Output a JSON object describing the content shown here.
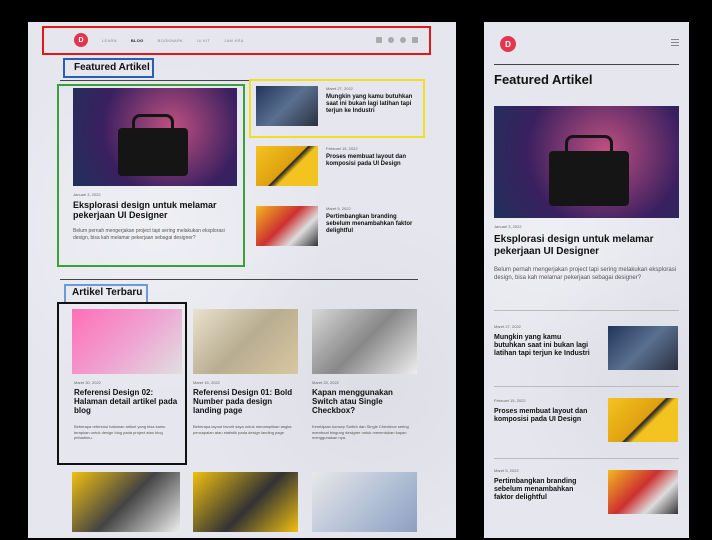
{
  "nav": {
    "logo": "D",
    "links": [
      "LEARN",
      "BLOG",
      "BOOKMARK",
      "UI KIT",
      "JAM KRA"
    ],
    "icons": [
      "share-icon",
      "globe-icon",
      "circle-icon",
      "video-icon"
    ]
  },
  "featured": {
    "title": "Featured Artikel",
    "main": {
      "date": "Januari 3, 2022",
      "title": "Eksplorasi design untuk melamar pekerjaan UI Designer",
      "excerpt": "Belum pernah mengerjakan project tapi sering melakukan eksplorasi design, bisa kah melamar pekerjaan sebagai designer?"
    },
    "side": [
      {
        "date": "Maret 27, 2022",
        "title": "Mungkin yang kamu butuhkan saat ini bukan lagi latihan tapi terjun ke Industri"
      },
      {
        "date": "Februari 15, 2022",
        "title": "Proses membuat layout dan komposisi pada UI Design"
      },
      {
        "date": "Maret 5, 2022",
        "title": "Pertimbangkan branding sebelum menambahkan faktor delightful"
      }
    ]
  },
  "latest": {
    "title": "Artikel Terbaru",
    "cards": [
      {
        "date": "Maret 30, 2022",
        "title": "Referensi Design 02: Halaman detail artikel pada blog",
        "excerpt": "Beberapa referensi halaman artikel yang bisa kamu terapkan untuk design blog pada project atau blog pribadimu."
      },
      {
        "date": "Maret 15, 2022",
        "title": "Referensi Design 01: Bold Number pada design landing page",
        "excerpt": "Beberapa layout favorit saya untuk menampilkan angka pencapaian atau statistik pada design landing page"
      },
      {
        "date": "Maret 25, 2022",
        "title": "Kapan menggunakan Switch atau Single Checkbox?",
        "excerpt": "Kembijaan konsep Switch dan Single Checkbox sering membuat bingung designer untuk menentukan kapan menggunakan nya."
      }
    ]
  },
  "mobile": {
    "logo": "D",
    "featured_title": "Featured Artikel",
    "main_date": "Januari 3, 2022",
    "main_title": "Eksplorasi design untuk melamar pekerjaan UI Designer",
    "main_excerpt": "Belum pernah mengerjakan project tapi sering melakukan eksplorasi design, bisa kah melamar pekerjaan sebagai designer?",
    "items": [
      {
        "date": "Maret 27, 2022",
        "title": "Mungkin yang kamu butuhkan saat ini bukan lagi latihan tapi terjun ke Industri"
      },
      {
        "date": "Februari 15, 2022",
        "title": "Proses membuat layout dan komposisi pada UI Design"
      },
      {
        "date": "Maret 5, 2022",
        "title": "Pertimbangkan branding sebelum menambahkan faktor delightful"
      }
    ]
  },
  "annotation_colors": {
    "nav": "#e01818",
    "featured_title": "#2a5fb0",
    "main": "#3aa03a",
    "side": "#f0e020",
    "latest_title": "#6a9ad8",
    "card": "#111111"
  }
}
